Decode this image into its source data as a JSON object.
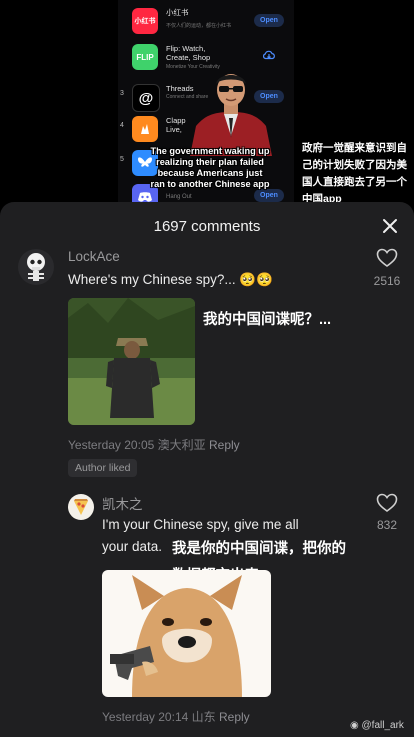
{
  "video": {
    "apps": [
      {
        "name": "小红书",
        "subtitle": "不仅人们的运动，都在小红书",
        "icon_label": "小红书",
        "icon_color": "#ff2741",
        "action": "Open"
      },
      {
        "name": "Flip: Watch,\nCreate, Shop",
        "subtitle": "Monetize Your Creativity",
        "icon_label": "FLIP",
        "icon_color": "#3fd26b",
        "action": "download-cloud-icon"
      },
      {
        "name": "Threads",
        "subtitle": "Connect and share",
        "icon_label": "@",
        "icon_color": "#000000",
        "action": "Open",
        "number": "3"
      },
      {
        "name": "Clapp\nLive,",
        "subtitle": "Dem",
        "icon_label": "clap",
        "icon_color": "#ff8a1f",
        "action": "",
        "number": "4"
      },
      {
        "name": "",
        "subtitle": "",
        "icon_label": "butterfly",
        "icon_color": "#2e8cff",
        "action": "",
        "number": "5"
      },
      {
        "name": "",
        "subtitle": "Hang Out",
        "icon_label": "discord",
        "icon_color": "#5865f2",
        "action": "Open"
      }
    ],
    "caption_en": "The government waking up realizing their plan failed because Americans just ran to another Chinese app",
    "caption_cn": "政府一觉醒来意识到自己的计划失败了因为美国人直接跑去了另一个中国app"
  },
  "sheet": {
    "title": "1697 comments",
    "comments": [
      {
        "username": "LockAce",
        "text": "Where's my Chinese spy?...",
        "emoji": "🥺🥺",
        "likes": "2516",
        "image_overlay": "我的中国间谍呢？...",
        "timestamp": "Yesterday 20:05",
        "location": "澳大利亚",
        "reply_label": "Reply",
        "badge": "Author liked"
      },
      {
        "username": "凯木之",
        "text_line1": "I'm your  Chinese spy, give me all",
        "text_line2": "your data.",
        "likes": "832",
        "overlay_line1": "我是你的中国间谍，把你的",
        "overlay_line2": "数据都交出来",
        "timestamp": "Yesterday 20:14",
        "location": "山东",
        "reply_label": "Reply"
      }
    ]
  },
  "watermark": "@fall_ark"
}
